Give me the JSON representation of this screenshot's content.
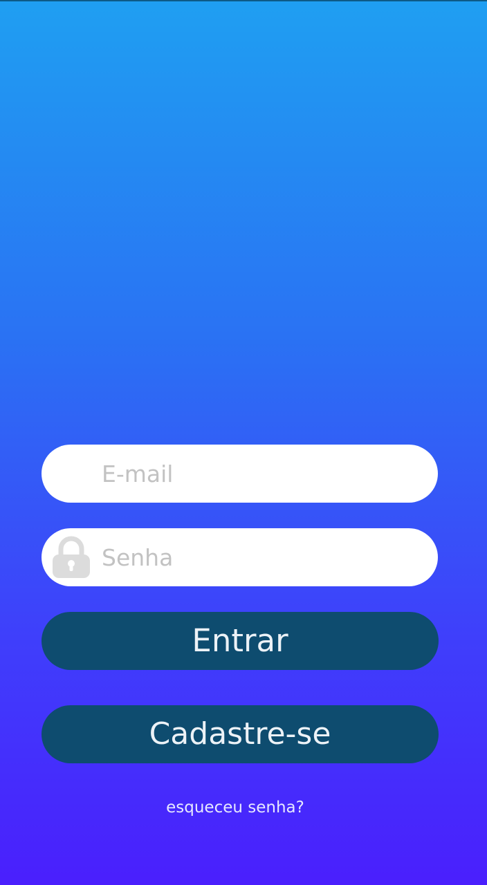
{
  "login": {
    "email": {
      "placeholder": "E-mail",
      "value": ""
    },
    "password": {
      "placeholder": "Senha",
      "value": ""
    },
    "submit_label": "Entrar",
    "register_label": "Cadastre-se",
    "forgot_label": "esqueceu senha?"
  },
  "icons": {
    "password": "lock-icon"
  },
  "colors": {
    "gradient_top": "#1f9ff2",
    "gradient_bottom": "#4a1ffd",
    "button_background": "#0e4c6f",
    "button_text": "#ecf2f7",
    "field_background": "#ffffff",
    "placeholder_text": "#c2c2c2"
  }
}
